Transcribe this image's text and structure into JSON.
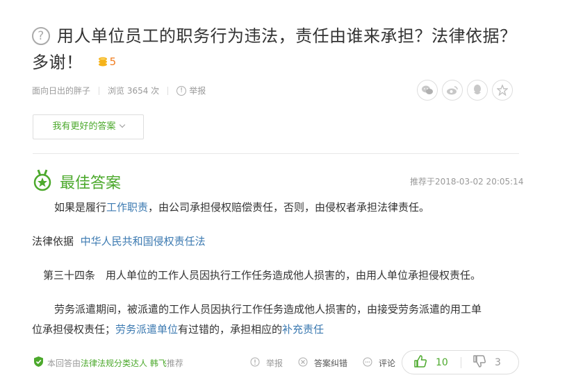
{
  "question": {
    "title_line1": "用人单位员工的职务行为违法，责任由谁来承担？法律依据？",
    "title_line2": "多谢！",
    "reward": "5",
    "author": "面向日出的胖子",
    "views": "浏览 3654 次",
    "report": "举报"
  },
  "share_icons": [
    "wechat-icon",
    "weibo-icon",
    "qq-icon",
    "qzone-icon"
  ],
  "better_answer_button": "我有更好的答案",
  "answer": {
    "badge_title": "最佳答案",
    "recommended_time": "推荐于2018-03-02 20:05:14",
    "p1_a": "如果是履行",
    "p1_link": "工作职责",
    "p1_b": "，由公司承担侵权赔偿责任，否则，由侵权者承担法律责任。",
    "p2_label": "法律依据",
    "p2_link": "中华人民共和国侵权责任法",
    "p3": "第三十四条　用人单位的工作人员因执行工作任务造成他人损害的，由用人单位承担侵权责任。",
    "p4_a": "劳务派遣期间，被派遣的工作人员因执行工作任务造成他人损害的，由接受劳务派遣的用工单",
    "p4_b": "位承担侵权责任；",
    "p4_link1": "劳务派遣单位",
    "p4_c": "有过错的，承担相应的",
    "p4_link2": "补充责任"
  },
  "footer": {
    "verified_a": "本回答由",
    "verified_org": "法律法规分类达人",
    "verified_user": "韩飞",
    "verified_b": "推荐",
    "report": "举报",
    "correction": "答案纠错",
    "comment": "评论",
    "likes": "10",
    "dislikes": "3"
  },
  "colors": {
    "accent_green": "#4ca92c",
    "link_blue": "#3c7ab1",
    "coin_orange": "#f17c1e"
  }
}
